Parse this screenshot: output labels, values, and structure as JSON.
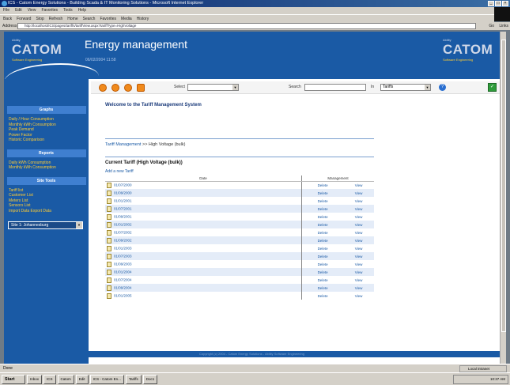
{
  "browser": {
    "title": "ICS - Catom Energy Solutions - Building Scada & IT Monitoring Solutions - Microsoft Internet Explorer",
    "menu": [
      "File",
      "Edit",
      "View",
      "Favorites",
      "Tools",
      "Help"
    ],
    "toolbar": [
      "Back",
      "Forward",
      "Stop",
      "Refresh",
      "Home",
      "Search",
      "Favorites",
      "Media",
      "History"
    ],
    "address_label": "Address",
    "address_value": "http://localhost/ICS/pages/tariffs/tariffView.aspx?tariffType=HighVoltage",
    "go_label": "Go",
    "links_label": "Links"
  },
  "header": {
    "logo_left": {
      "pre": "Ability",
      "name": "CATOM",
      "tagline": "Software Engineering"
    },
    "logo_right": {
      "pre": "Ability",
      "name": "CATOM",
      "tagline": "Software Engineering"
    },
    "title": "Energy management",
    "subtitle": "06/02/2004 11:58"
  },
  "controls": {
    "select1_label": "Select",
    "select2_label": "Search",
    "select3_label": "In",
    "select3_value": "Tariffs"
  },
  "sidebar": {
    "sections": [
      {
        "heading": "Graphs",
        "links": [
          "Daily / Hour Consumption",
          "Monthly kWh Consumption",
          "Peak Demand",
          "Power Factor",
          "Historic Comparison"
        ]
      },
      {
        "heading": "Reports",
        "links": [
          "Daily kWh Consumption",
          "Monthly kWh Consumption"
        ]
      },
      {
        "heading": "Site Tools",
        "links": [
          "Tariff list",
          "Customer List",
          "Meters List",
          "Sensors List",
          "Import Data Export Data"
        ]
      }
    ],
    "select_value": "Site 1: Johannesburg"
  },
  "main": {
    "welcome": "Welcome to the Tariff Management System",
    "breadcrumb_link": "Tariff Management",
    "breadcrumb_rest": " >> High Voltage (bulk)",
    "section_title": "Current Tariff (High Voltage (bulk))",
    "add_link": "Add a new Tariff",
    "col_date": "Date",
    "col_mgmt": "Management",
    "action_delete": "Delete",
    "action_view": "View",
    "rows": [
      "01/07/2000",
      "01/09/2000",
      "01/01/2001",
      "01/07/2001",
      "01/09/2001",
      "01/01/2002",
      "01/07/2002",
      "01/09/2002",
      "01/01/2003",
      "01/07/2003",
      "01/09/2003",
      "01/01/2004",
      "01/07/2004",
      "01/09/2004",
      "01/01/2005"
    ]
  },
  "footer": "Copyright (c) 2004 - Catom Energy Solutions - Ability Software Engineering",
  "status": {
    "text": "Done",
    "zone": "Local intranet"
  },
  "taskbar": {
    "start": "Start",
    "tasks": [
      "Inbox",
      "ICS",
      "Catom",
      "Edit",
      "ICS - Catom En...",
      "Tariffs",
      "Doc1"
    ],
    "clock": "10:37 AM"
  }
}
